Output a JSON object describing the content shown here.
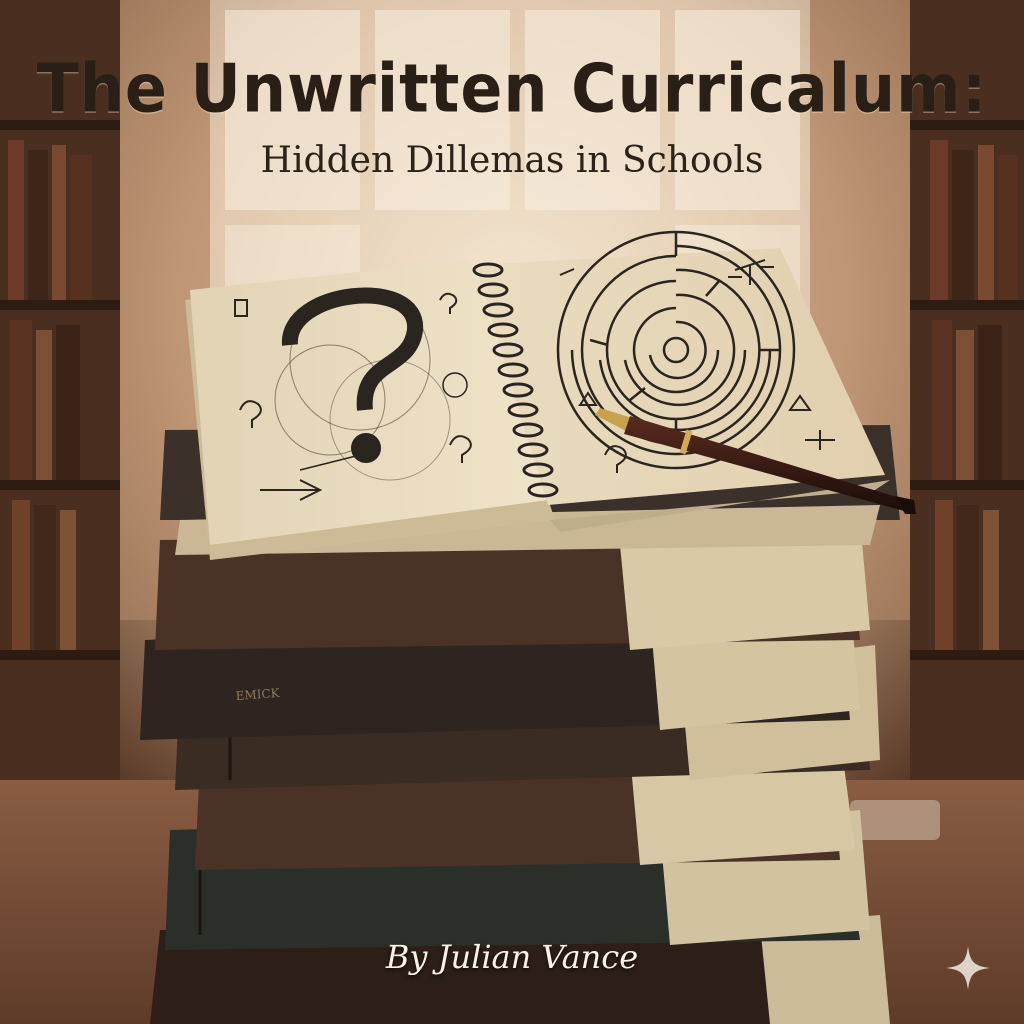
{
  "cover": {
    "title": "The Unwritten Curricalum:",
    "subtitle": "Hidden Dillemas in Schools",
    "author": "By Julian Vance"
  },
  "spine_text": "EMICK",
  "icons": [
    "question-mark-doodle",
    "maze-doodle",
    "fountain-pen",
    "sparkle-icon"
  ],
  "colors": {
    "title": "#2a1f17",
    "author": "#fbf4e6",
    "paper": "#e9dcc0",
    "ink": "#2b2520",
    "book_dark": "#2e2520",
    "book_brown": "#4a3226"
  }
}
